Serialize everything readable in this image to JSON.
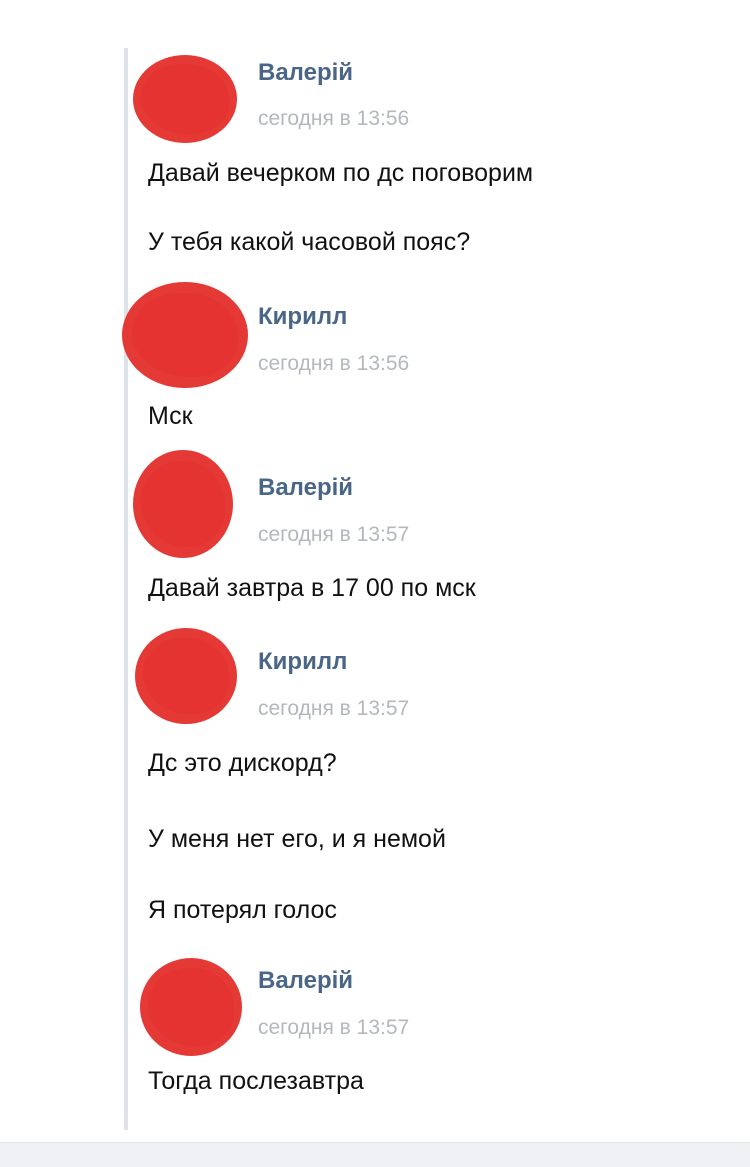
{
  "colors": {
    "author_name": "#4a6687",
    "timestamp": "#b3b8be",
    "message_text": "#111111",
    "avatar_redaction": "#e53935",
    "thread_line": "#dfe3e8"
  },
  "messages": [
    {
      "author": "Валерій",
      "time": "сегодня в 13:56",
      "lines": [
        "Давай вечерком по дс поговорим",
        "У тебя какой часовой пояс?"
      ]
    },
    {
      "author": "Кирилл",
      "time": "сегодня в 13:56",
      "lines": [
        "Мск"
      ]
    },
    {
      "author": "Валерій",
      "time": "сегодня в 13:57",
      "lines": [
        "Давай завтра в 17 00 по мск"
      ]
    },
    {
      "author": "Кирилл",
      "time": "сегодня в 13:57",
      "lines": [
        "Дс это дискорд?",
        "У меня нет его, и я немой",
        "Я потерял голос"
      ]
    },
    {
      "author": "Валерій",
      "time": "сегодня в 13:57",
      "lines": [
        "Тогда послезавтра"
      ]
    }
  ]
}
